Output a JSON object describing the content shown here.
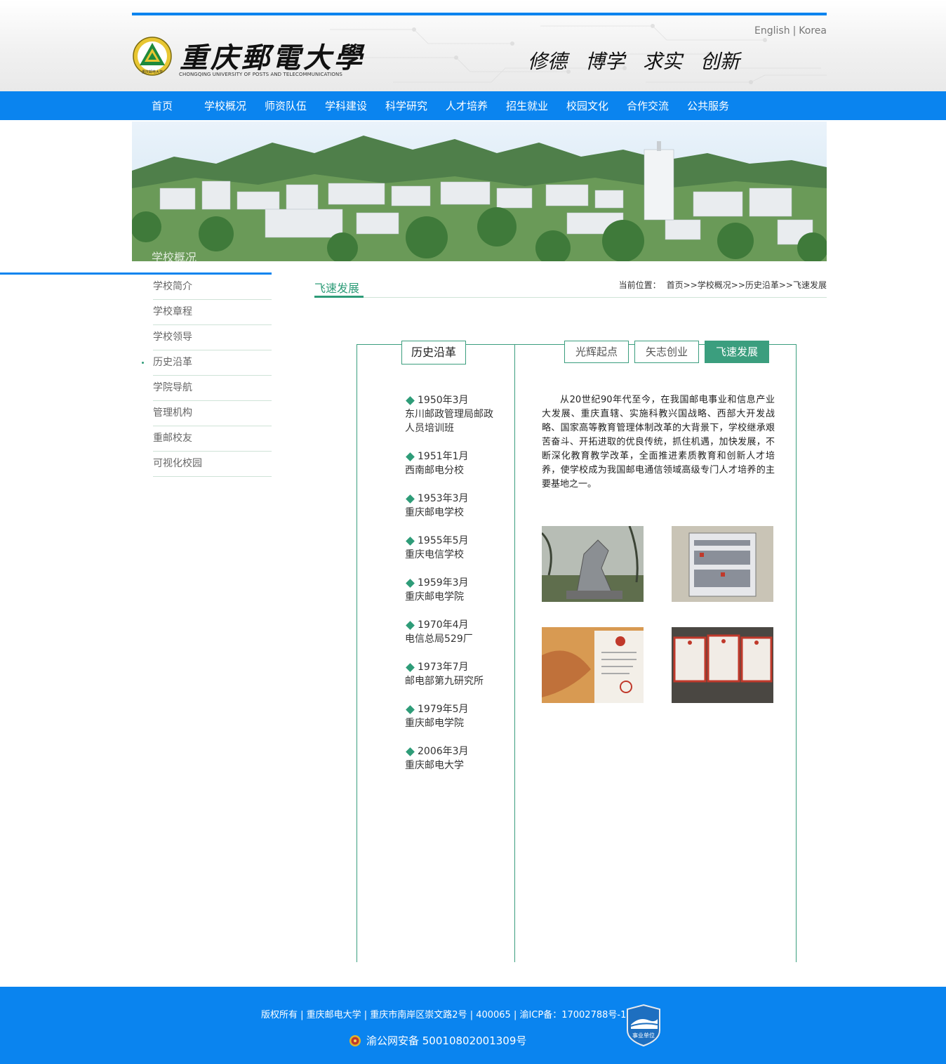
{
  "header": {
    "school_name_cn": "重庆郵電大學",
    "school_name_en": "CHONGQING UNIVERSITY OF POSTS AND TELECOMMUNICATIONS",
    "motto": [
      "修德",
      "博学",
      "求实",
      "创新"
    ],
    "lang": {
      "english": "English",
      "separator": "|",
      "korea": "Korea"
    }
  },
  "nav": {
    "items": [
      "首页",
      "学校概况",
      "师资队伍",
      "学科建设",
      "科学研究",
      "人才培养",
      "招生就业",
      "校园文化",
      "合作交流",
      "公共服务"
    ]
  },
  "banner": {
    "label": "学校概况"
  },
  "sidebar": {
    "items": [
      "学校简介",
      "学校章程",
      "学校领导",
      "历史沿革",
      "学院导航",
      "管理机构",
      "重邮校友",
      "可视化校园"
    ],
    "active": "历史沿革"
  },
  "content": {
    "title": "飞速发展",
    "breadcrumb": {
      "label": "当前位置：",
      "path": "首页>>学校概况>>历史沿革>>飞速发展"
    }
  },
  "history": {
    "tab_label": "历史沿革",
    "tabs": [
      "光辉起点",
      "矢志创业",
      "飞速发展"
    ],
    "active_tab": "飞速发展",
    "timeline": [
      {
        "date": "1950年3月",
        "name": "东川邮政管理局邮政人员培训班"
      },
      {
        "date": "1951年1月",
        "name": "西南邮电分校"
      },
      {
        "date": "1953年3月",
        "name": "重庆邮电学校"
      },
      {
        "date": "1955年5月",
        "name": "重庆电信学校"
      },
      {
        "date": "1959年3月",
        "name": "重庆邮电学院"
      },
      {
        "date": "1970年4月",
        "name": "电信总局529厂"
      },
      {
        "date": "1973年7月",
        "name": "邮电部第九研究所"
      },
      {
        "date": "1979年5月",
        "name": "重庆邮电学院"
      },
      {
        "date": "2006年3月",
        "name": "重庆邮电大学"
      }
    ],
    "paragraph": "从20世纪90年代至今，在我国邮电事业和信息产业大发展、重庆直辖、实施科教兴国战略、西部大开发战略、国家高等教育管理体制改革的大背景下，学校继承艰苦奋斗、开拓进取的优良传统，抓住机遇，加快发展，不断深化教育教学改革，全面推进素质教育和创新人才培养，使学校成为我国邮电通信领域高级专门人才培养的主要基地之一。"
  },
  "footer": {
    "line1": "版权所有 | 重庆邮电大学 | 重庆市南岸区崇文路2号 | 400065 | 渝ICP备：17002788号-1",
    "line2": "渝公网安备 50010802001309号",
    "badge_text": "事业单位"
  },
  "colors": {
    "primary_blue": "#0a84ef",
    "accent_green": "#2e9c78"
  }
}
